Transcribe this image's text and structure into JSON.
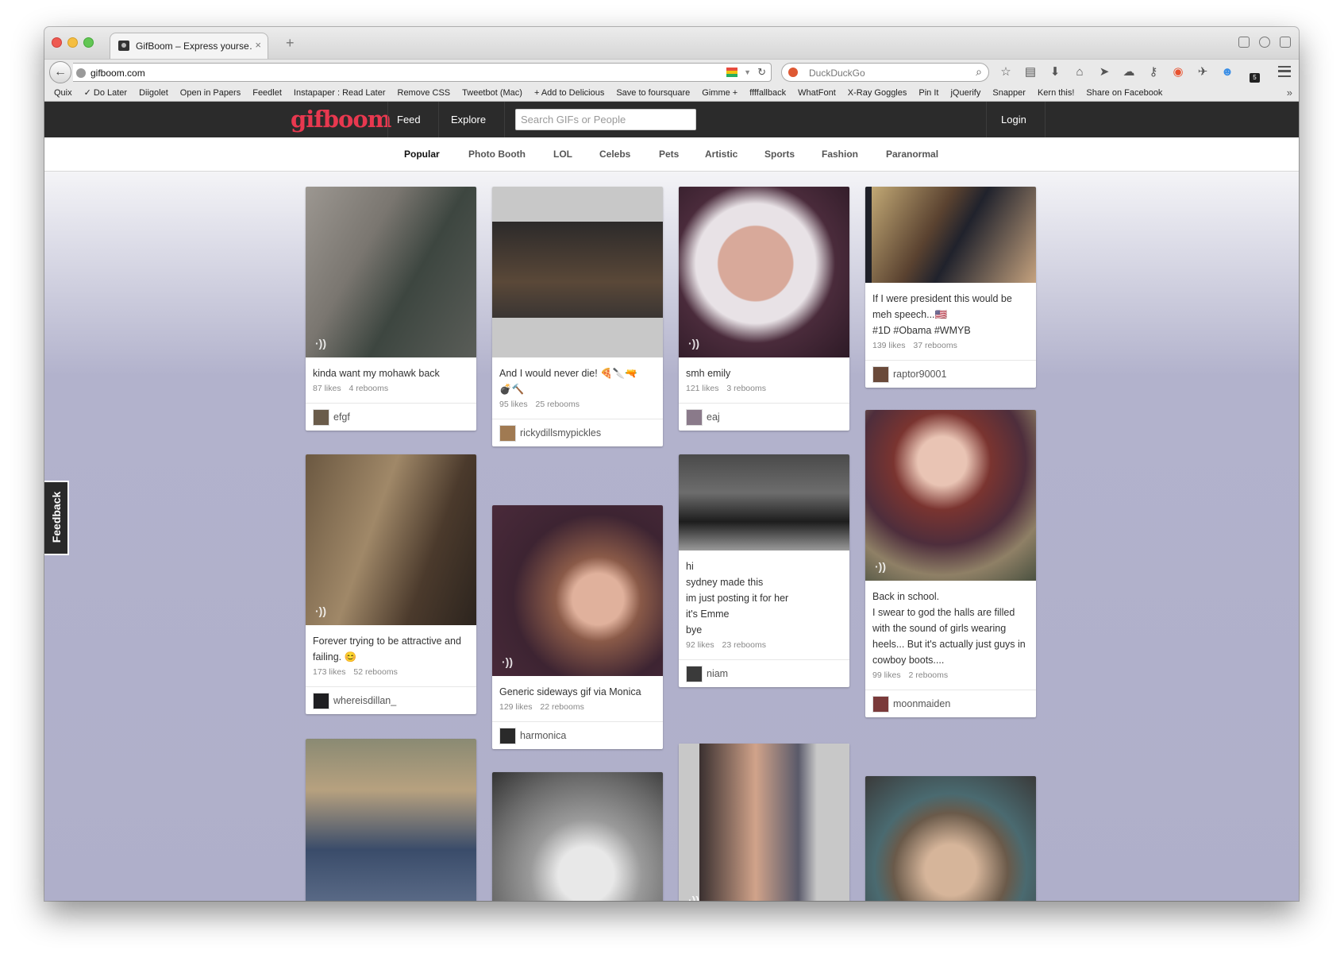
{
  "browser": {
    "tab_title": "GifBoom – Express yourse…",
    "tab_close": "×",
    "new_tab": "+",
    "back": "←",
    "url": "gifboom.com",
    "search_engine": "DuckDuckGo",
    "bookmarks": [
      "Quix",
      "✓  Do Later",
      "Diigolet",
      "Open in Papers",
      "Feedlet",
      "Instapaper : Read Later",
      "Remove CSS",
      "Tweetbot (Mac)",
      "+ Add to Delicious",
      "Save to foursquare",
      "Gimme +",
      "ffffallback",
      "WhatFont",
      "X-Ray Goggles",
      "Pin It",
      "jQuerify",
      "Snapper",
      "Kern this!",
      "Share on Facebook"
    ],
    "bookmarks_more": "»",
    "badge": "5",
    "toolbar_icons": [
      "star-icon",
      "reading-list-icon",
      "download-icon",
      "home-icon",
      "send-icon",
      "cloud-icon",
      "key-icon",
      "duckduckgo-icon",
      "bird-icon",
      "ghostery-icon"
    ]
  },
  "site": {
    "logo": "gifboom",
    "nav": [
      "Feed",
      "Explore"
    ],
    "search_placeholder": "Search GIFs or People",
    "login": "Login",
    "feedback": "Feedback",
    "accent": "#e8384f",
    "categories": [
      "Popular",
      "Photo Booth",
      "LOL",
      "Celebs",
      "Pets",
      "Artistic",
      "Sports",
      "Fashion",
      "Paranormal"
    ]
  },
  "cards": [
    {
      "caption": "kinda want my mohawk back",
      "likes": "87 likes",
      "reblooms": "4 rebooms",
      "user": "efgf"
    },
    {
      "caption": "And I would never die! 🍕🔪🔫\n💣🔨",
      "likes": "95 likes",
      "reblooms": "25 rebooms",
      "user": "rickydillsmypickles"
    },
    {
      "caption": "smh emily",
      "likes": "121 likes",
      "reblooms": "3 rebooms",
      "user": "eaj"
    },
    {
      "caption": "If I were president this would be meh speech...🇺🇸\n#1D #Obama #WMYB",
      "likes": "139 likes",
      "reblooms": "37 rebooms",
      "user": "raptor90001"
    },
    {
      "caption": "Forever trying to be attractive and failing. 😊",
      "likes": "173 likes",
      "reblooms": "52 rebooms",
      "user": "whereisdillan_"
    },
    {
      "caption": "Generic sideways gif via Monica",
      "likes": "129 likes",
      "reblooms": "22 rebooms",
      "user": "harmonica"
    },
    {
      "caption": "hi\nsydney made this\nim just posting it for her\nit's Emme\nbye",
      "likes": "92 likes",
      "reblooms": "23 rebooms",
      "user": "niam"
    },
    {
      "caption": "Back in school.\nI swear to god the halls are filled with the sound of girls wearing heels... But it's actually just guys in cowboy boots....",
      "likes": "99 likes",
      "reblooms": "2 rebooms",
      "user": "moonmaiden"
    }
  ]
}
